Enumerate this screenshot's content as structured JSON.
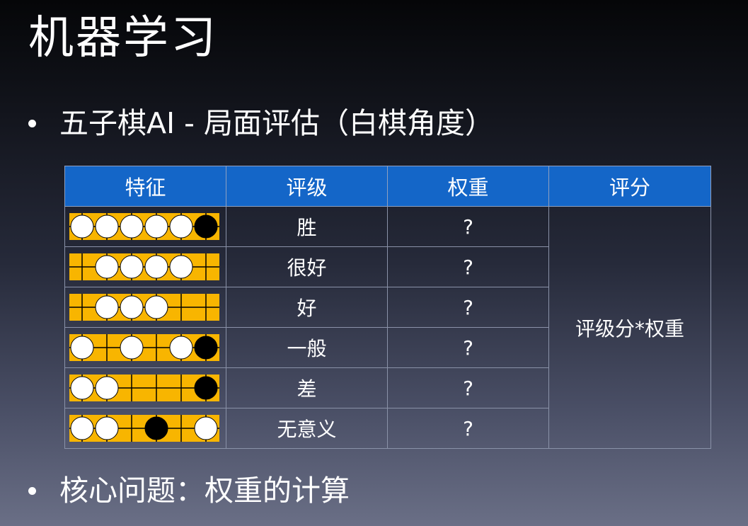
{
  "slide": {
    "title": "机器学习",
    "bullet1": "五子棋AI - 局面评估（白棋角度）",
    "bullet2": "核心问题：权重的计算"
  },
  "table": {
    "headers": [
      "特征",
      "评级",
      "权重",
      "评分"
    ],
    "rows": [
      {
        "pattern": "WWWWWB",
        "rating": "胜",
        "weight": "?"
      },
      {
        "pattern": ".WWWW.",
        "rating": "很好",
        "weight": "?"
      },
      {
        "pattern": ".WWW..",
        "rating": "好",
        "weight": "?"
      },
      {
        "pattern": "W.W.WB",
        "rating": "一般",
        "weight": "?"
      },
      {
        "pattern": "WW...B",
        "rating": "差",
        "weight": "?"
      },
      {
        "pattern": "WW.B.W",
        "rating": "无意义",
        "weight": "?"
      }
    ],
    "score_formula": "评级分*权重"
  },
  "colors": {
    "header_blue": "#1466c8",
    "board_yellow": "#f8b500",
    "white_stone": "#ffffff",
    "black_stone": "#000000"
  }
}
